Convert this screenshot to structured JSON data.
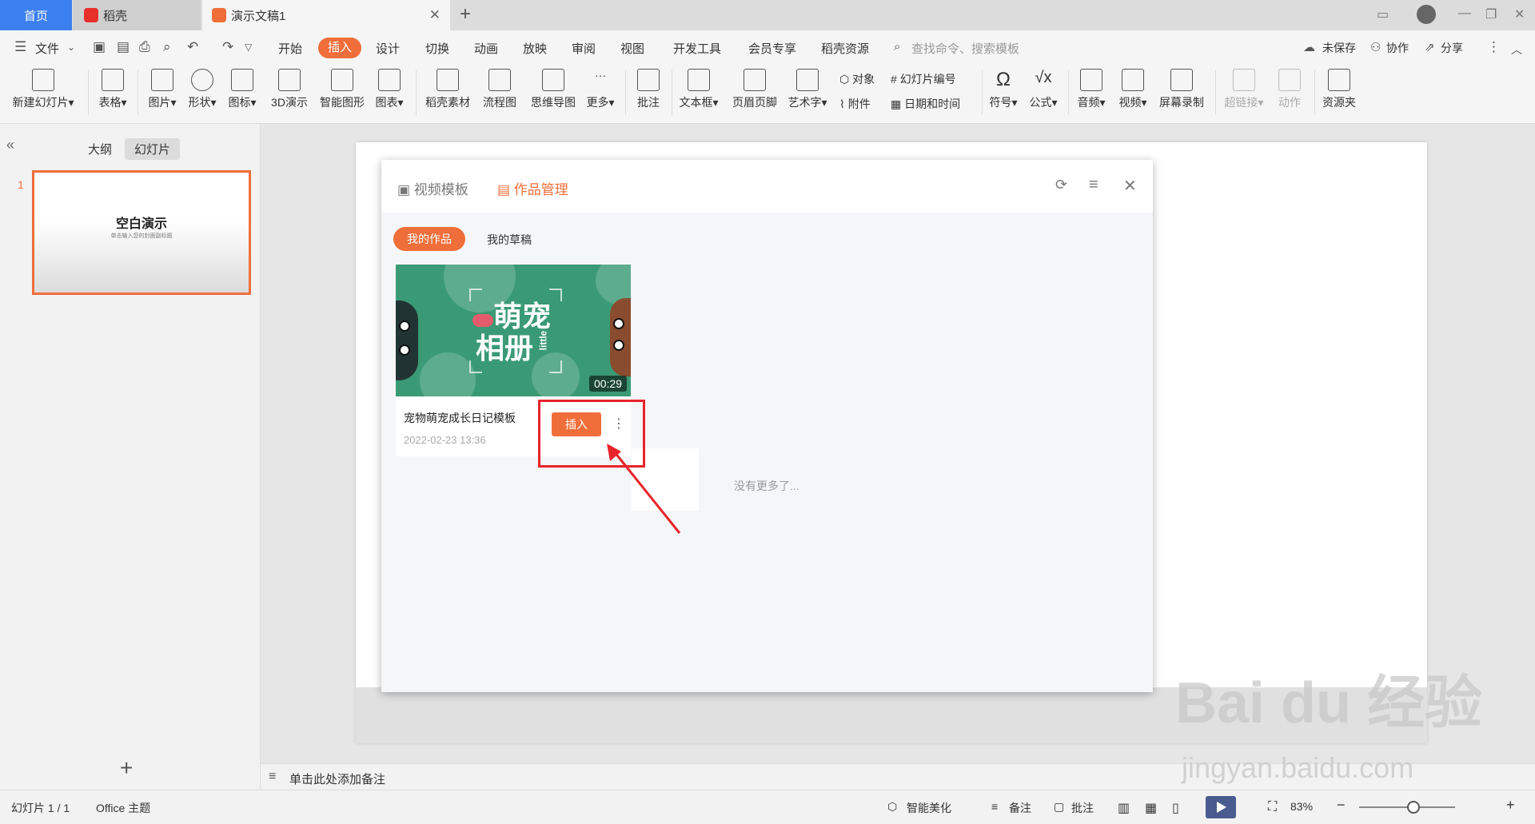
{
  "tabs": {
    "home": "首页",
    "daoke": "稻壳",
    "doc": "演示文稿1"
  },
  "menu": {
    "file": "文件",
    "items": [
      "开始",
      "插入",
      "设计",
      "切换",
      "动画",
      "放映",
      "审阅",
      "视图",
      "开发工具",
      "会员专享",
      "稻壳资源"
    ],
    "active": "插入",
    "search_placeholder": "查找命令、搜索模板",
    "unsaved": "未保存",
    "collab": "协作",
    "share": "分享"
  },
  "ribbon": {
    "new_slide": "新建幻灯片",
    "table": "表格",
    "picture": "图片",
    "shape": "形状",
    "icon": "图标",
    "threed": "3D演示",
    "smart_graphic": "智能图形",
    "chart": "图表",
    "daoke_material": "稻壳素材",
    "flowchart": "流程图",
    "mindmap": "思维导图",
    "more": "更多",
    "comment": "批注",
    "textbox": "文本框",
    "header_footer": "页眉页脚",
    "art_text": "艺术字",
    "object": "对象",
    "attachment": "附件",
    "slide_number": "幻灯片编号",
    "datetime": "日期和时间",
    "symbol": "符号",
    "formula": "公式",
    "audio": "音频",
    "video": "视频",
    "screen_record": "屏幕录制",
    "hyperlink": "超链接",
    "action": "动作",
    "resource": "资源夹"
  },
  "left_panel": {
    "outline": "大纲",
    "slides": "幻灯片",
    "thumb_number": "1",
    "thumb_title": "空白演示",
    "thumb_subtitle": "单击输入您的封面副标题"
  },
  "notes_placeholder": "单击此处添加备注",
  "dialog": {
    "tab_video_template": "视频模板",
    "tab_works": "作品管理",
    "my_works": "我的作品",
    "my_drafts": "我的草稿",
    "card": {
      "title_image_text_1": "萌宠",
      "title_image_text_2": "相册",
      "little": "little",
      "duration": "00:29",
      "title": "宠物萌宠成长日记模板",
      "date": "2022-02-23 13:36",
      "insert": "插入"
    },
    "no_more": "没有更多了..."
  },
  "status": {
    "slide_count": "幻灯片 1 / 1",
    "theme": "Office 主题",
    "beautify": "智能美化",
    "notes": "备注",
    "comments": "批注",
    "zoom": "83%"
  },
  "watermark": {
    "brand": "Bai du 经验",
    "url": "jingyan.baidu.com"
  }
}
